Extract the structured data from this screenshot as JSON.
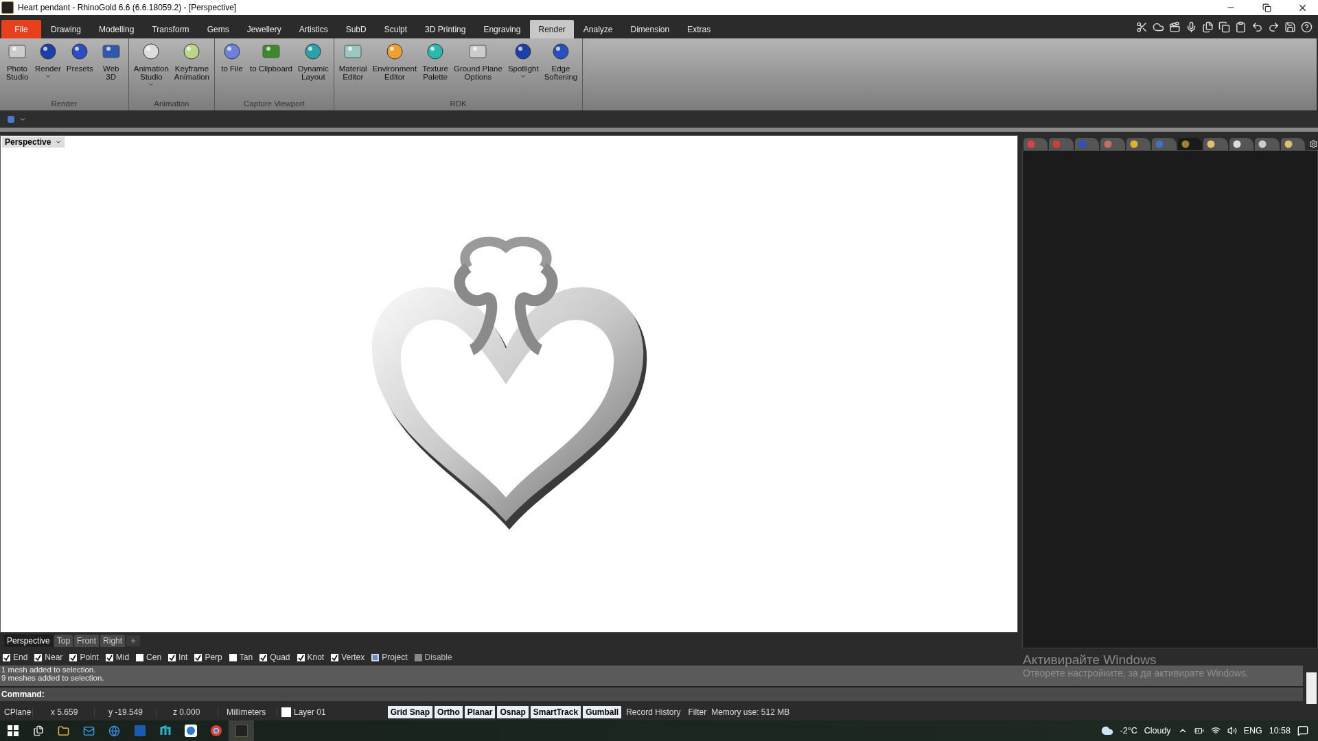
{
  "window": {
    "title": "Heart pendant - RhinoGold 6.6 (6.6.18059.2) - [Perspective]"
  },
  "menu_tabs": [
    {
      "label": "File",
      "kind": "file",
      "selected": false
    },
    {
      "label": "Drawing",
      "kind": "tab",
      "selected": false
    },
    {
      "label": "Modelling",
      "kind": "tab",
      "selected": false
    },
    {
      "label": "Transform",
      "kind": "tab",
      "selected": false
    },
    {
      "label": "Gems",
      "kind": "tab",
      "selected": false
    },
    {
      "label": "Jewellery",
      "kind": "tab",
      "selected": false
    },
    {
      "label": "Artistics",
      "kind": "tab",
      "selected": false
    },
    {
      "label": "SubD",
      "kind": "tab",
      "selected": false
    },
    {
      "label": "Sculpt",
      "kind": "tab",
      "selected": false
    },
    {
      "label": "3D Printing",
      "kind": "tab",
      "selected": false
    },
    {
      "label": "Engraving",
      "kind": "tab",
      "selected": false
    },
    {
      "label": "Render",
      "kind": "tab",
      "selected": true
    },
    {
      "label": "Analyze",
      "kind": "tab",
      "selected": false
    },
    {
      "label": "Dimension",
      "kind": "tab",
      "selected": false
    },
    {
      "label": "Extras",
      "kind": "tab",
      "selected": false
    }
  ],
  "ribbon_groups": [
    {
      "title": "Render",
      "buttons": [
        {
          "label": "Photo\nStudio",
          "has_menu": false
        },
        {
          "label": "Render",
          "has_menu": true
        },
        {
          "label": "Presets",
          "has_menu": false
        },
        {
          "label": "Web\n3D",
          "has_menu": false
        }
      ]
    },
    {
      "title": "Animation",
      "buttons": [
        {
          "label": "Animation\nStudio",
          "has_menu": true
        },
        {
          "label": "Keyframe\nAnimation",
          "has_menu": false
        }
      ]
    },
    {
      "title": "Capture Viewport",
      "buttons": [
        {
          "label": "to File",
          "has_menu": false
        },
        {
          "label": "to Clipboard",
          "has_menu": false
        },
        {
          "label": "Dynamic\nLayout",
          "has_menu": false
        }
      ]
    },
    {
      "title": "RDK",
      "buttons": [
        {
          "label": "Material\nEditor",
          "has_menu": false
        },
        {
          "label": "Environment\nEditor",
          "has_menu": false
        },
        {
          "label": "Texture\nPalette",
          "has_menu": false
        },
        {
          "label": "Ground Plane\nOptions",
          "has_menu": false
        },
        {
          "label": "Spotlight",
          "has_menu": true
        },
        {
          "label": "Edge\nSoftening",
          "has_menu": false
        }
      ]
    }
  ],
  "viewport": {
    "title": "Perspective"
  },
  "panel_tabs": [
    {
      "selected": false
    },
    {
      "selected": false
    },
    {
      "selected": false
    },
    {
      "selected": false
    },
    {
      "selected": false
    },
    {
      "selected": false
    },
    {
      "selected": true
    },
    {
      "selected": false
    },
    {
      "selected": false
    },
    {
      "selected": false
    },
    {
      "selected": false
    }
  ],
  "viewport_tabs": [
    {
      "label": "Perspective",
      "selected": true
    },
    {
      "label": "Top",
      "selected": false
    },
    {
      "label": "Front",
      "selected": false
    },
    {
      "label": "Right",
      "selected": false
    }
  ],
  "osnaps": [
    {
      "label": "End",
      "kind": "check",
      "checked": true
    },
    {
      "label": "Near",
      "kind": "check",
      "checked": true
    },
    {
      "label": "Point",
      "kind": "check",
      "checked": true
    },
    {
      "label": "Mid",
      "kind": "check",
      "checked": true
    },
    {
      "label": "Cen",
      "kind": "check",
      "checked": false
    },
    {
      "label": "Int",
      "kind": "check",
      "checked": true
    },
    {
      "label": "Perp",
      "kind": "check",
      "checked": true
    },
    {
      "label": "Tan",
      "kind": "check",
      "checked": false
    },
    {
      "label": "Quad",
      "kind": "check",
      "checked": true
    },
    {
      "label": "Knot",
      "kind": "check",
      "checked": true
    },
    {
      "label": "Vertex",
      "kind": "check",
      "checked": true
    },
    {
      "label": "Project",
      "kind": "mixed",
      "checked": false
    },
    {
      "label": "Disable",
      "kind": "disabled",
      "checked": false
    }
  ],
  "command_history": [
    "1 mesh added to selection.",
    "9 meshes added to selection."
  ],
  "command": {
    "label": "Command:"
  },
  "status_bar": {
    "cplane": "CPlane",
    "x": "x 5.659",
    "y": "y -19.549",
    "z": "z 0.000",
    "units": "Millimeters",
    "layer": "Layer 01",
    "toggles": [
      {
        "label": "Grid Snap",
        "on": true
      },
      {
        "label": "Ortho",
        "on": true
      },
      {
        "label": "Planar",
        "on": true
      },
      {
        "label": "Osnap",
        "on": true
      },
      {
        "label": "SmartTrack",
        "on": true
      },
      {
        "label": "Gumball",
        "on": true
      },
      {
        "label": "Record History",
        "on": false
      },
      {
        "label": "Filter",
        "on": false
      }
    ],
    "memory": "Memory use: 512 MB"
  },
  "activation": {
    "title": "Активирайте Windows",
    "text": "Отворете настройките, за да активирате Windows."
  },
  "taskbar": {
    "temperature": "-2°C",
    "weather": "Cloudy",
    "language": "ENG",
    "time": "10:58"
  }
}
